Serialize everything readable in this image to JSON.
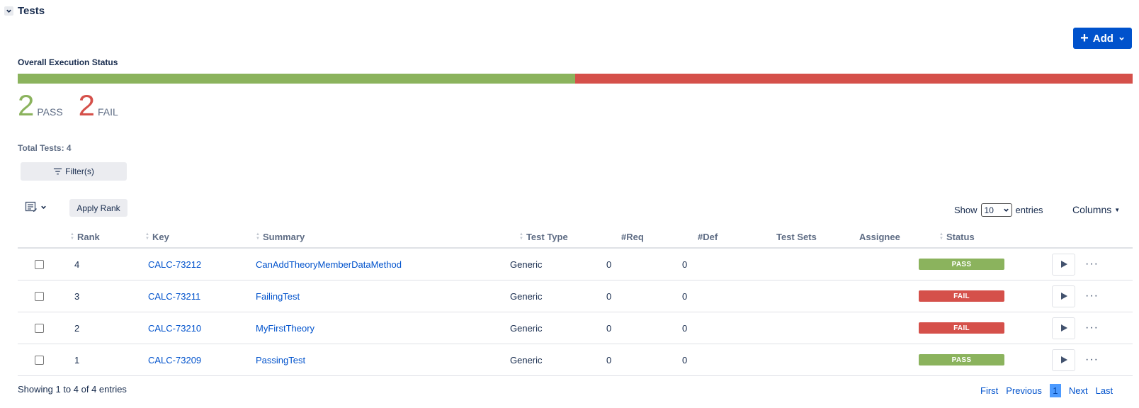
{
  "section": {
    "title": "Tests"
  },
  "add_button": {
    "label": "Add"
  },
  "execution": {
    "label": "Overall Execution Status",
    "pass_fraction": 0.5,
    "fail_fraction": 0.5,
    "pass_count": "2",
    "pass_label": "PASS",
    "fail_count": "2",
    "fail_label": "FAIL",
    "total_label": "Total Tests: 4"
  },
  "filter": {
    "label": "Filter(s)"
  },
  "apply_rank": {
    "label": "Apply Rank"
  },
  "show_entries": {
    "show": "Show",
    "value": "10",
    "entries": "entries"
  },
  "columns_button": {
    "label": "Columns"
  },
  "table": {
    "headers": {
      "rank": "Rank",
      "key": "Key",
      "summary": "Summary",
      "test_type": "Test Type",
      "req": "#Req",
      "def": "#Def",
      "test_sets": "Test Sets",
      "assignee": "Assignee",
      "status": "Status"
    },
    "rows": [
      {
        "rank": "4",
        "key": "CALC-73212",
        "summary": "CanAddTheoryMemberDataMethod",
        "test_type": "Generic",
        "req": "0",
        "def": "0",
        "test_sets": "",
        "assignee": "",
        "status": "PASS"
      },
      {
        "rank": "3",
        "key": "CALC-73211",
        "summary": "FailingTest",
        "test_type": "Generic",
        "req": "0",
        "def": "0",
        "test_sets": "",
        "assignee": "",
        "status": "FAIL"
      },
      {
        "rank": "2",
        "key": "CALC-73210",
        "summary": "MyFirstTheory",
        "test_type": "Generic",
        "req": "0",
        "def": "0",
        "test_sets": "",
        "assignee": "",
        "status": "FAIL"
      },
      {
        "rank": "1",
        "key": "CALC-73209",
        "summary": "PassingTest",
        "test_type": "Generic",
        "req": "0",
        "def": "0",
        "test_sets": "",
        "assignee": "",
        "status": "PASS"
      }
    ]
  },
  "footer": {
    "info": "Showing 1 to 4 of 4 entries"
  },
  "pagination": {
    "first": "First",
    "previous": "Previous",
    "current": "1",
    "next": "Next",
    "last": "Last"
  },
  "colors": {
    "pass": "#8bb35d",
    "fail": "#d5504a",
    "primary": "#0052cc"
  },
  "icons": {
    "collapse": "chevron-down-icon",
    "add": "plus-icon",
    "filter": "filter-icon",
    "column_selector": "column-edit-icon",
    "run": "play-icon",
    "more": "more-icon"
  }
}
